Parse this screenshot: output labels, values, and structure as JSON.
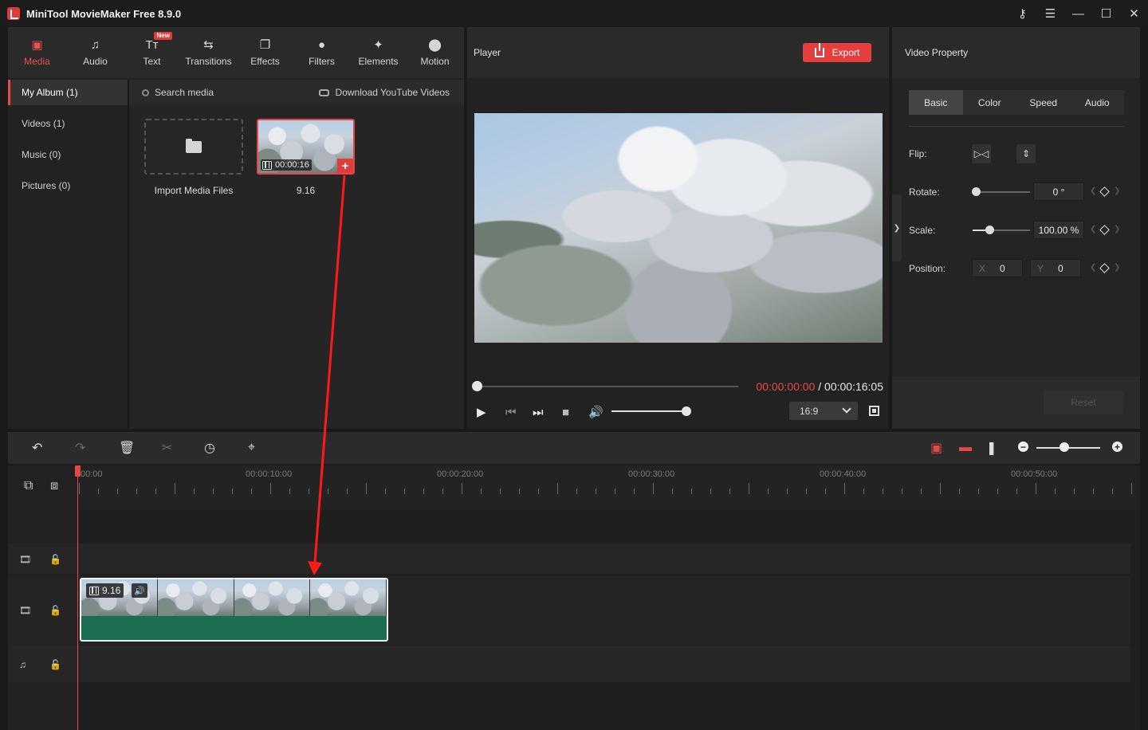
{
  "app": {
    "title": "MiniTool MovieMaker Free 8.9.0",
    "window_controls": [
      "key-icon",
      "menu-icon",
      "minimize-icon",
      "maximize-icon",
      "close-icon"
    ]
  },
  "toolbar": {
    "tabs": [
      {
        "label": "Media",
        "icon": "media-icon",
        "active": true
      },
      {
        "label": "Audio",
        "icon": "music-note-icon"
      },
      {
        "label": "Text",
        "icon": "text-icon",
        "badge": "New"
      },
      {
        "label": "Transitions",
        "icon": "transitions-icon"
      },
      {
        "label": "Effects",
        "icon": "effects-icon"
      },
      {
        "label": "Filters",
        "icon": "filters-icon"
      },
      {
        "label": "Elements",
        "icon": "elements-icon"
      },
      {
        "label": "Motion",
        "icon": "motion-icon"
      }
    ]
  },
  "album": {
    "items": [
      {
        "label": "My Album  (1)",
        "active": true
      },
      {
        "label": "Videos  (1)"
      },
      {
        "label": "Music  (0)"
      },
      {
        "label": "Pictures  (0)"
      }
    ]
  },
  "media": {
    "search_label": "Search media",
    "download_link": "Download YouTube Videos",
    "import_label": "Import Media Files",
    "clip": {
      "duration": "00:00:16",
      "name": "9.16"
    }
  },
  "player": {
    "title": "Player",
    "export_label": "Export",
    "current_time": "00:00:00:00",
    "separator": " / ",
    "total_time": "00:00:16:05",
    "aspect_ratio": "16:9"
  },
  "property": {
    "title": "Video Property",
    "tabs": [
      "Basic",
      "Color",
      "Speed",
      "Audio"
    ],
    "active_tab": "Basic",
    "flip_label": "Flip:",
    "rotate_label": "Rotate:",
    "rotate_value": "0 °",
    "scale_label": "Scale:",
    "scale_value": "100.00 %",
    "position_label": "Position:",
    "pos_x_label": "X",
    "pos_x_value": "0",
    "pos_y_label": "Y",
    "pos_y_value": "0",
    "reset_label": "Reset"
  },
  "timeline": {
    "ruler_labels": [
      "00:00",
      "00:00:10:00",
      "00:00:20:00",
      "00:00:30:00",
      "00:00:40:00",
      "00:00:50:00"
    ],
    "clip_name": "9.16",
    "accent_color": "#e64848",
    "clip_color": "#1b6e50"
  }
}
